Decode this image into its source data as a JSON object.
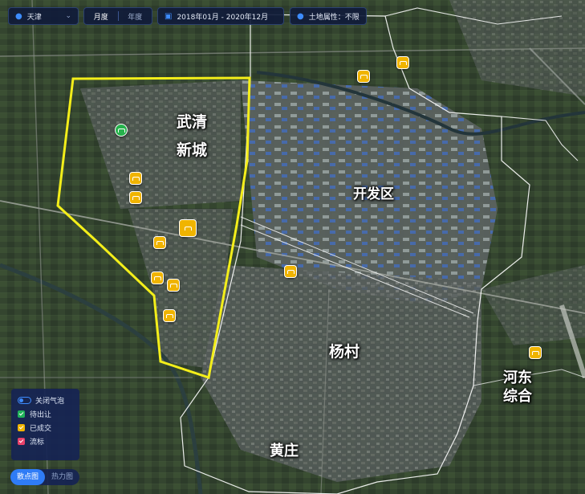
{
  "filters": {
    "city": "天津",
    "period_tabs": [
      "月度",
      "年度"
    ],
    "active_period": "月度",
    "date_range": "2018年01月 - 2020年12月",
    "land_attribute": "土地属性：不限"
  },
  "regions": {
    "wuqing_line1": "武清",
    "wuqing_line2": "新城",
    "kaifaqu": "开发区",
    "yangcun": "杨村",
    "hedong_line1": "河东",
    "hedong_line2": "综合",
    "huangzhuang": "黄庄"
  },
  "legend": {
    "toggle_label": "关闭气泡",
    "items": [
      {
        "label": "待出让",
        "color": "#21b25a"
      },
      {
        "label": "已成交",
        "color": "#f0b400"
      },
      {
        "label": "流标",
        "color": "#e8416a"
      }
    ]
  },
  "view_switch": {
    "options": [
      "散点图",
      "热力图"
    ],
    "active": "散点图"
  },
  "colors": {
    "panel_bg": "#101b3a",
    "accent": "#2f7cf6",
    "highlight_boundary": "#f3ee1a",
    "district_boundary": "#ffffff",
    "marker_deal": "#f0b400",
    "marker_pending": "#26b24c"
  }
}
